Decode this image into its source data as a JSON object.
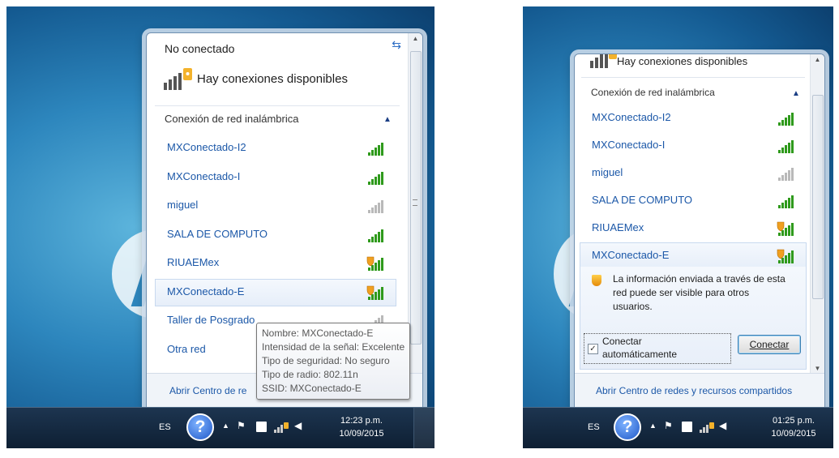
{
  "left": {
    "status": "No conectado",
    "available": "Hay conexiones disponibles",
    "section": "Conexión de red inalámbrica",
    "networks": [
      {
        "name": "MXConectado-I2",
        "secured": false,
        "faded": false
      },
      {
        "name": "MXConectado-I",
        "secured": false,
        "faded": false
      },
      {
        "name": "miguel",
        "secured": false,
        "faded": true
      },
      {
        "name": "SALA DE COMPUTO",
        "secured": false,
        "faded": false
      },
      {
        "name": "RIUAEMex",
        "secured": true,
        "faded": false
      },
      {
        "name": "MXConectado-E",
        "secured": true,
        "faded": false
      },
      {
        "name": "Taller de Posgrado",
        "secured": false,
        "faded": true
      },
      {
        "name": "Otra red",
        "secured": false,
        "faded": false
      }
    ],
    "footer": "Abrir Centro de re",
    "tooltip": [
      "Nombre: MXConectado-E",
      "Intensidad de la señal: Excelente",
      "Tipo de seguridad: No seguro",
      "Tipo de radio: 802.11n",
      "SSID: MXConectado-E"
    ],
    "taskbar": {
      "lang": "ES",
      "time": "12:23 p.m.",
      "date": "10/09/2015",
      "help": "?"
    }
  },
  "right": {
    "available": "Hay conexiones disponibles",
    "section": "Conexión de red inalámbrica",
    "networks": [
      {
        "name": "MXConectado-I2",
        "secured": false,
        "faded": false
      },
      {
        "name": "MXConectado-I",
        "secured": false,
        "faded": false
      },
      {
        "name": "miguel",
        "secured": false,
        "faded": true
      },
      {
        "name": "SALA DE COMPUTO",
        "secured": false,
        "faded": false
      },
      {
        "name": "RIUAEMex",
        "secured": true,
        "faded": false
      },
      {
        "name": "MXConectado-E",
        "secured": true,
        "faded": false
      }
    ],
    "warning_lines": [
      "La información enviada a través de esta",
      "red puede ser visible para otros",
      "usuarios."
    ],
    "auto_connect_lines": [
      "Conectar",
      "automáticamente"
    ],
    "auto_connect_checked": true,
    "connect_button": "Conectar",
    "footer": "Abrir Centro de redes y recursos compartidos",
    "taskbar": {
      "lang": "ES",
      "time": "01:25 p.m.",
      "date": "10/09/2015",
      "help": "?"
    }
  },
  "colors": {
    "link": "#1c58a8",
    "signal_green": "#2f9a1c",
    "signal_faded": "#b9b9b9",
    "shield": "#f0a020"
  },
  "icons": [
    "help-icon",
    "flag-icon",
    "network-icon",
    "volume-icon",
    "wireless-signal-icon",
    "security-shield-icon",
    "refresh-icon",
    "chevron-up-icon"
  ]
}
